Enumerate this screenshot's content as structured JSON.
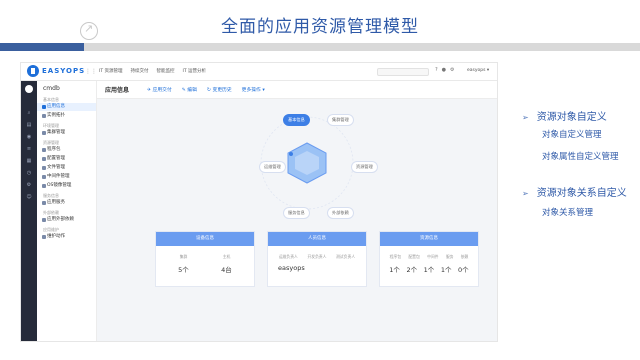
{
  "slide": {
    "title": "全面的应用资源管理模型"
  },
  "colors": {
    "band_blue": "#3a5f9e",
    "band_gray": "#d9d9d9",
    "accent": "#1e6fd9",
    "card_head": "#6a9cf0",
    "hex_fill": "#9bc2f5"
  },
  "app": {
    "brand": "EASYOPS",
    "topnav": [
      "IT 资源管理",
      "持续交付",
      "智能监控",
      "IT 运营分析"
    ],
    "user": "easyops ▾",
    "sidebar": {
      "title": "cmdb",
      "groups": [
        {
          "label": "基本信息",
          "items": [
            {
              "label": "应用信息",
              "active": true
            },
            {
              "label": "实例拓扑",
              "active": false
            }
          ]
        },
        {
          "label": "环境管理",
          "items": [
            {
              "label": "集群管理",
              "active": false
            }
          ]
        },
        {
          "label": "资源管理",
          "items": [
            {
              "label": "程序包",
              "active": false
            },
            {
              "label": "配置管理",
              "active": false
            },
            {
              "label": "文件管理",
              "active": false
            },
            {
              "label": "中间件管理",
              "active": false
            },
            {
              "label": "OS镜像管理",
              "active": false
            }
          ]
        },
        {
          "label": "服务信息",
          "items": [
            {
              "label": "应用服务",
              "active": false
            }
          ]
        },
        {
          "label": "外部依赖",
          "items": [
            {
              "label": "应用外部依赖",
              "active": false
            }
          ]
        },
        {
          "label": "应用维护",
          "items": [
            {
              "label": "维护动作",
              "active": false
            }
          ]
        }
      ]
    },
    "page_heading": "应用信息",
    "actions": [
      {
        "icon": "send-icon",
        "label": "应用交付"
      },
      {
        "icon": "edit-icon",
        "label": "编辑"
      },
      {
        "icon": "history-icon",
        "label": "变更历史"
      },
      {
        "icon": "more-icon",
        "label": "更多操作 ▾"
      }
    ],
    "diagram_nodes": [
      "基本信息",
      "集群管理",
      "资源管理",
      "外部依赖",
      "服务信息",
      "运维管理"
    ],
    "cards": [
      {
        "title": "设备信息",
        "labels": [
          "集群",
          "主机"
        ],
        "values": [
          "5个",
          "4台"
        ]
      },
      {
        "title": "人员信息",
        "labels": [
          "运维负责人",
          "开发负责人",
          "测试负责人"
        ],
        "values": [
          "easyops",
          "",
          ""
        ]
      },
      {
        "title": "资源信息",
        "labels": [
          "程序包",
          "配置包",
          "中间件",
          "服务",
          "依赖"
        ],
        "values": [
          "1个",
          "2个",
          "1个",
          "1个",
          "0个"
        ]
      }
    ]
  },
  "bullets": [
    {
      "label": "资源对象自定义",
      "sub": [
        "对象自定义管理",
        "对象属性自定义管理"
      ]
    },
    {
      "label": "资源对象关系自定义",
      "sub": [
        "对象关系管理"
      ]
    }
  ]
}
